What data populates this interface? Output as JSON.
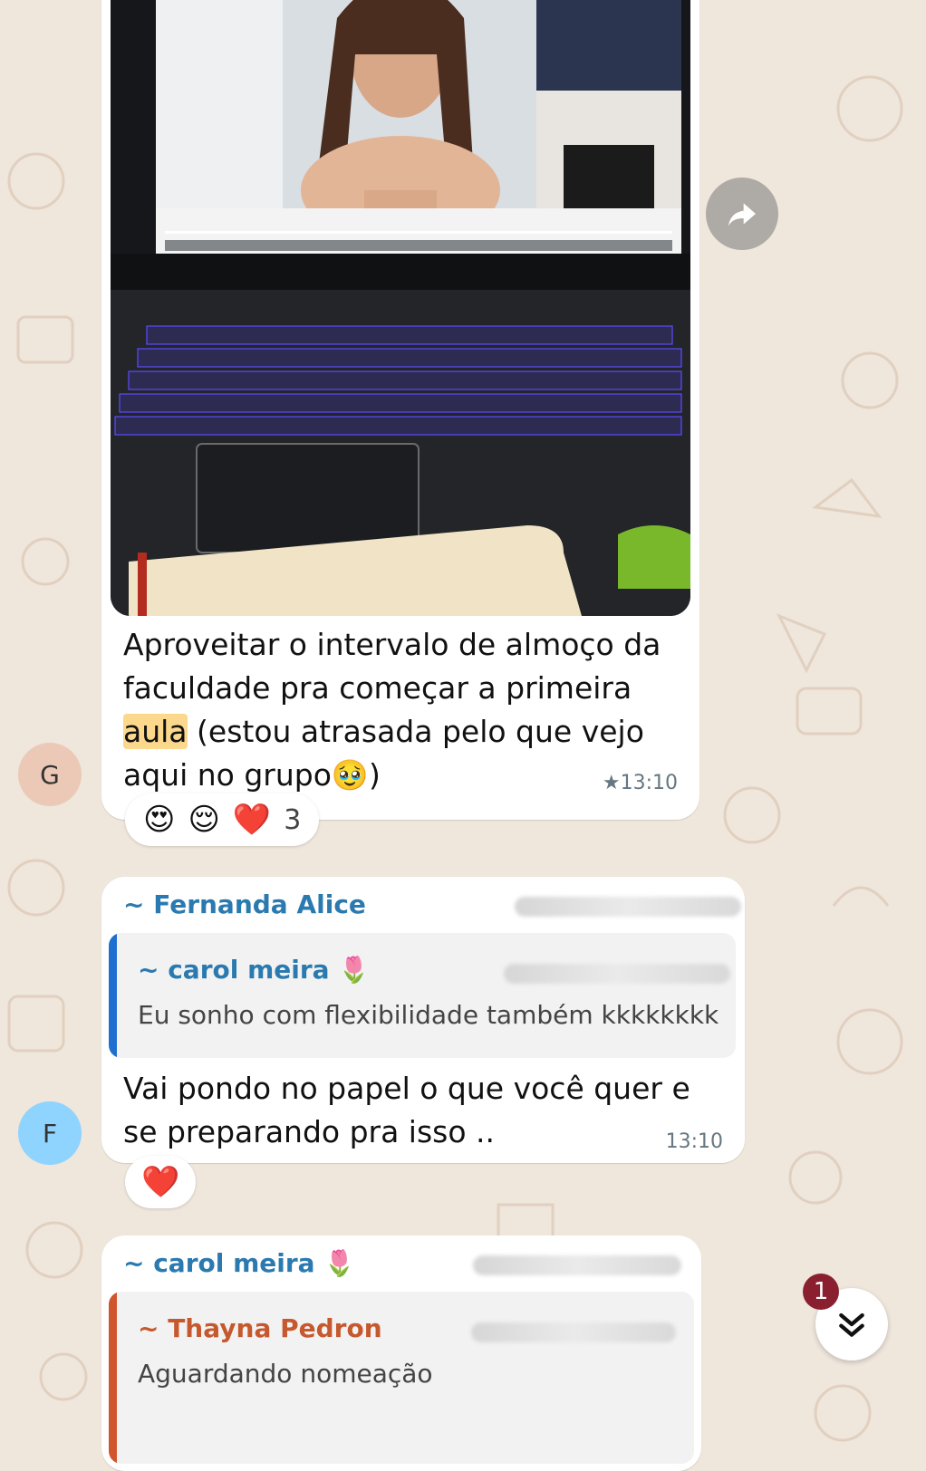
{
  "messages": {
    "first": {
      "avatar_letter": "G",
      "text_before": "Aproveitar o intervalo de almoço da faculdade pra começar a primeira ",
      "highlighted_word": "aula",
      "text_after": " (estou atrasada pelo que vejo aqui no grupo",
      "emoji": "🥹",
      "text_end": ")",
      "time": "★13:10",
      "reactions": [
        "😍",
        "😌",
        "❤️"
      ],
      "reaction_count": "3"
    },
    "second": {
      "avatar_letter": "F",
      "sender": "~ Fernanda Alice",
      "quote_sender": "~ carol meira 🌷",
      "quote_text": "Eu sonho com flexibilidade também kkkkkkkk",
      "text": "Vai pondo no papel o que você quer e se preparando pra isso ..",
      "time": "13:10",
      "reactions": [
        "❤️"
      ]
    },
    "third": {
      "sender": "~ carol meira 🌷",
      "quote_sender": "~ Thayna Pedron",
      "quote_text": "Aguardando nomeação"
    }
  },
  "scroll_button": {
    "unread_badge": "1"
  },
  "colors": {
    "sender_blue": "#2a7ab0",
    "quote_blue": "#1f6fd1",
    "quote_red": "#d0552d",
    "badge": "#8a1f2f"
  }
}
